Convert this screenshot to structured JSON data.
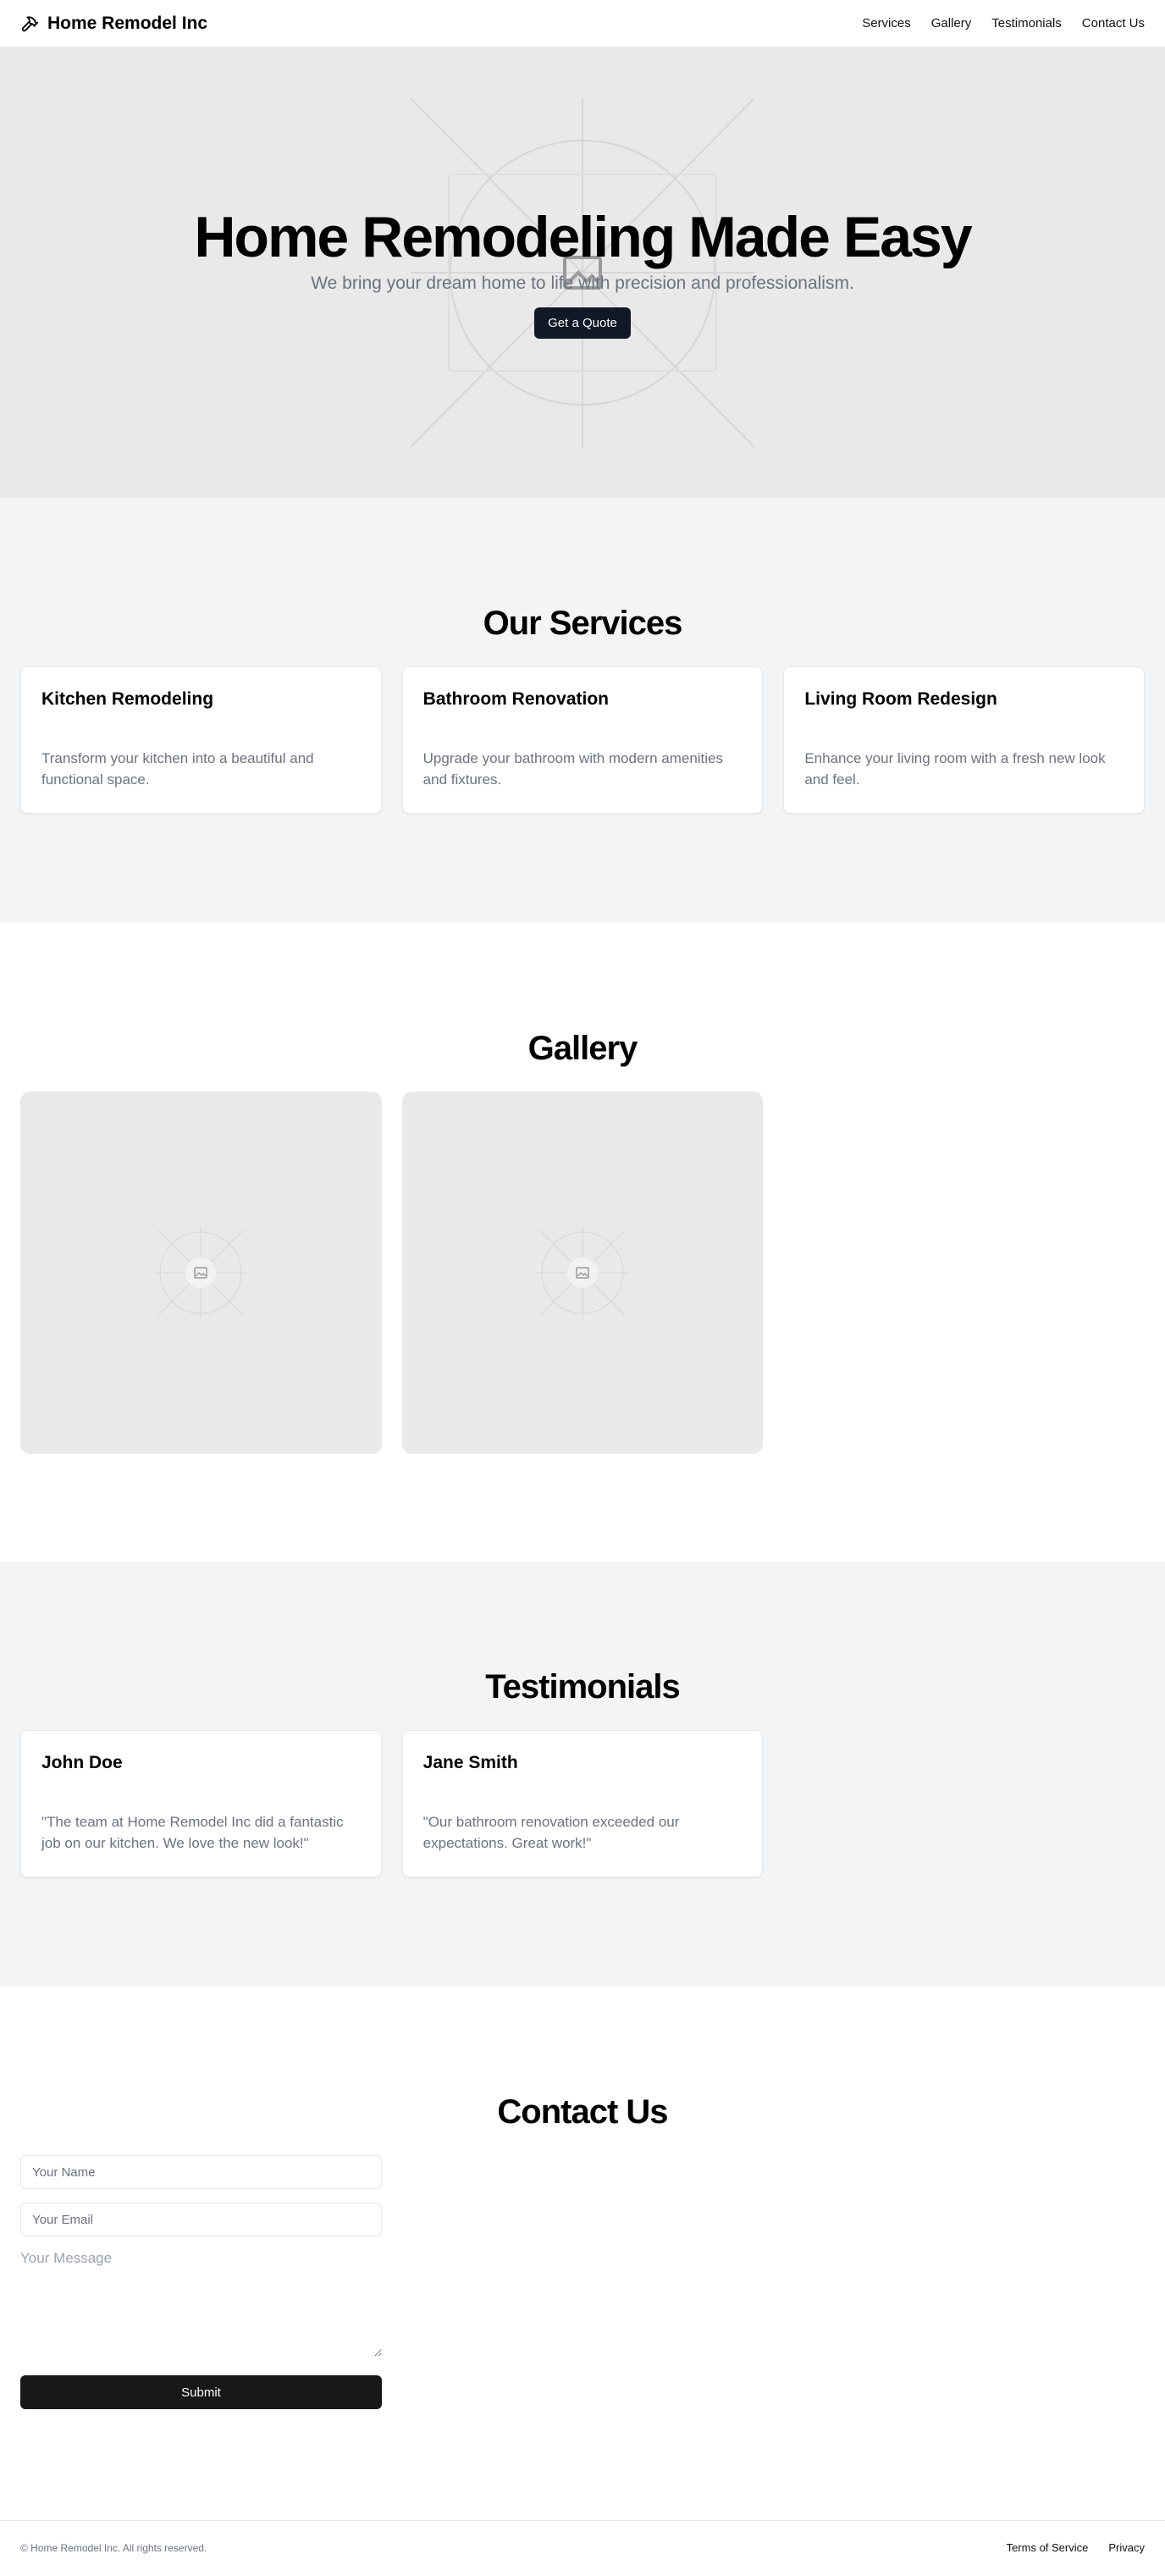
{
  "header": {
    "brand": "Home Remodel Inc",
    "logo_icon": "hammer-icon",
    "nav": [
      "Services",
      "Gallery",
      "Testimonials",
      "Contact Us"
    ]
  },
  "hero": {
    "title": "Home Remodeling Made Easy",
    "subtitle": "We bring your dream home to life with precision and professionalism.",
    "cta": "Get a Quote",
    "background_icon": "image-placeholder-icon"
  },
  "services": {
    "title": "Our Services",
    "items": [
      {
        "title": "Kitchen Remodeling",
        "text": "Transform your kitchen into a beautiful and functional space."
      },
      {
        "title": "Bathroom Renovation",
        "text": "Upgrade your bathroom with modern amenities and fixtures."
      },
      {
        "title": "Living Room Redesign",
        "text": "Enhance your living room with a fresh new look and feel."
      }
    ]
  },
  "gallery": {
    "title": "Gallery",
    "item_icon": "image-placeholder-icon"
  },
  "testimonials": {
    "title": "Testimonials",
    "items": [
      {
        "name": "John Doe",
        "quote": "\"The team at Home Remodel Inc did a fantastic job on our kitchen. We love the new look!\""
      },
      {
        "name": "Jane Smith",
        "quote": "\"Our bathroom renovation exceeded our expectations. Great work!\""
      }
    ]
  },
  "contact": {
    "title": "Contact Us",
    "name_placeholder": "Your Name",
    "email_placeholder": "Your Email",
    "message_placeholder": "Your Message",
    "submit": "Submit"
  },
  "footer": {
    "copyright": "© Home Remodel Inc. All rights reserved.",
    "links": [
      "Terms of Service",
      "Privacy"
    ]
  },
  "colors": {
    "primary_dark": "#111827",
    "muted_text": "#6b7280",
    "section_gray": "#f3f4f6",
    "placeholder_bg": "#e9e9e9"
  }
}
